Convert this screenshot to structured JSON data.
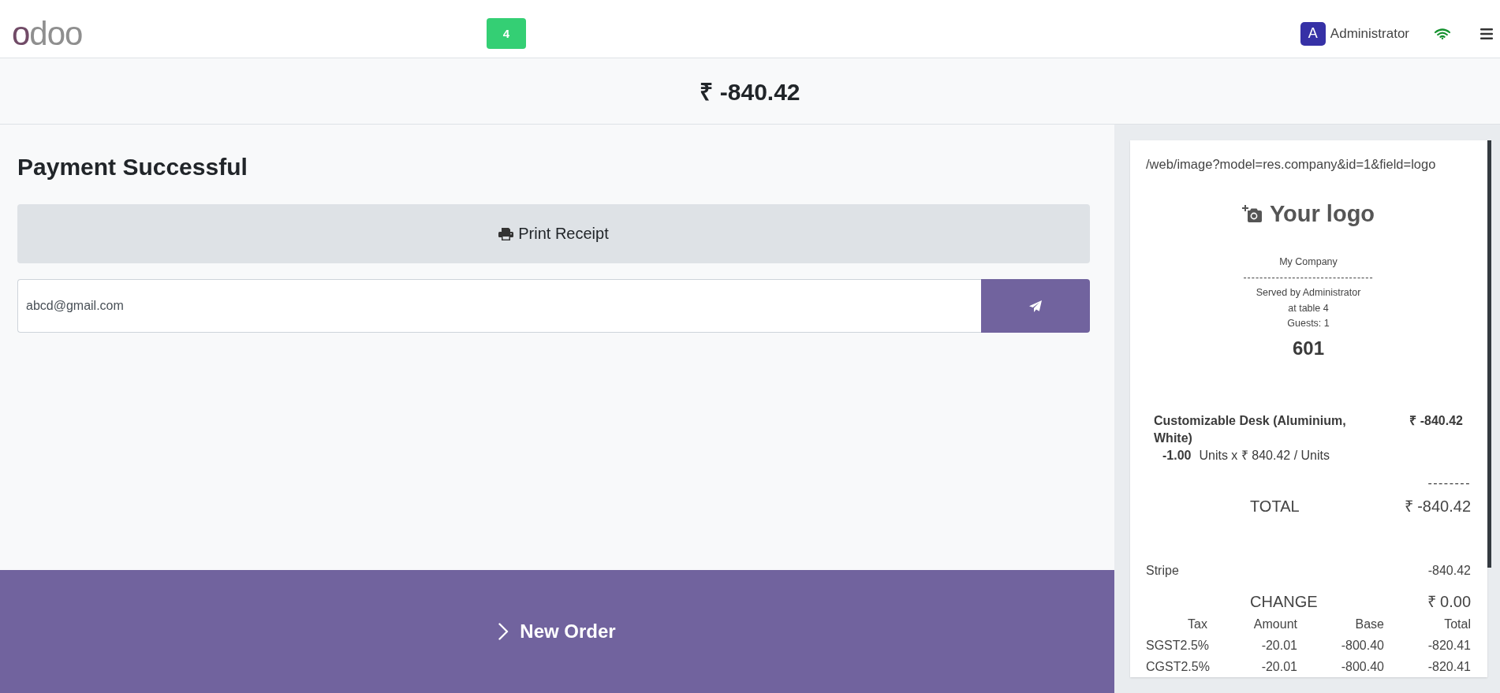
{
  "header": {
    "logo": "odoo",
    "table_badge": "4",
    "user": {
      "initial": "A",
      "name": "Administrator"
    },
    "connected": true
  },
  "amount_due": "₹ -840.42",
  "payment": {
    "title": "Payment Successful",
    "print_button": "Print Receipt",
    "email": {
      "value": "abcd@gmail.com"
    },
    "new_order_button": "New Order"
  },
  "receipt": {
    "logo_url": "/web/image?model=res.company&id=1&field=logo",
    "logo_placeholder": "Your logo",
    "company": "My Company",
    "separator": "--------------------------------",
    "served_by": "Served by Administrator",
    "table": "at table 4",
    "guests": "Guests: 1",
    "order_number": "601",
    "lines": [
      {
        "product": "Customizable Desk (Aluminium, White)",
        "price": "₹ -840.42",
        "quantity": "-1.00",
        "unit_detail": "Units x ₹ 840.42 / Units"
      }
    ],
    "total_separator": "--------",
    "total": {
      "label": "TOTAL",
      "value": "₹ -840.42"
    },
    "payments": [
      {
        "method": "Stripe",
        "amount": "-840.42"
      }
    ],
    "change": {
      "label": "CHANGE",
      "value": "₹ 0.00"
    },
    "taxes": {
      "columns": [
        "Tax",
        "Amount",
        "Base",
        "Total"
      ],
      "rows": [
        [
          "SGST2.5%",
          "-20.01",
          "-800.40",
          "-820.41"
        ],
        [
          "CGST2.5%",
          "-20.01",
          "-800.40",
          "-820.41"
        ]
      ]
    }
  }
}
